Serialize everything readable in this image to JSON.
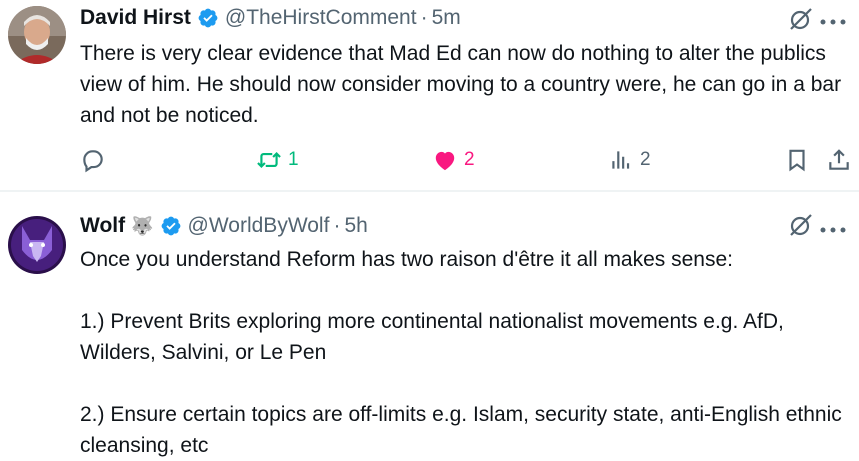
{
  "tweets": [
    {
      "name": "David Hirst",
      "handle": "@TheHirstComment",
      "separator": "·",
      "time": "5m",
      "body": "There is very clear evidence that Mad Ed can now do nothing to alter the publics view of him.  He should now consider moving to a country were, he can go in a bar and not be noticed.",
      "retweets": "1",
      "likes": "2",
      "views": "2"
    },
    {
      "name": "Wolf",
      "name_emoji": "🐺",
      "handle": "@WorldByWolf",
      "separator": "·",
      "time": "5h",
      "body_lines": [
        "Once you understand Reform has two raison d'être it all makes sense:",
        "1.) Prevent Brits exploring more continental nationalist movements e.g. AfD, Wilders, Salvini, or Le Pen",
        "2.) Ensure certain topics are off-limits e.g. Islam, security state, anti-English ethnic cleansing, etc"
      ]
    }
  ],
  "colors": {
    "verified": "#1d9bf0",
    "retweet_active": "#00ba7c",
    "like_active": "#f91880",
    "muted": "#536471"
  },
  "icons": [
    "grok-icon",
    "more-icon",
    "reply-icon",
    "retweet-icon",
    "heart-icon",
    "views-icon",
    "bookmark-icon",
    "share-icon",
    "verified-icon"
  ]
}
